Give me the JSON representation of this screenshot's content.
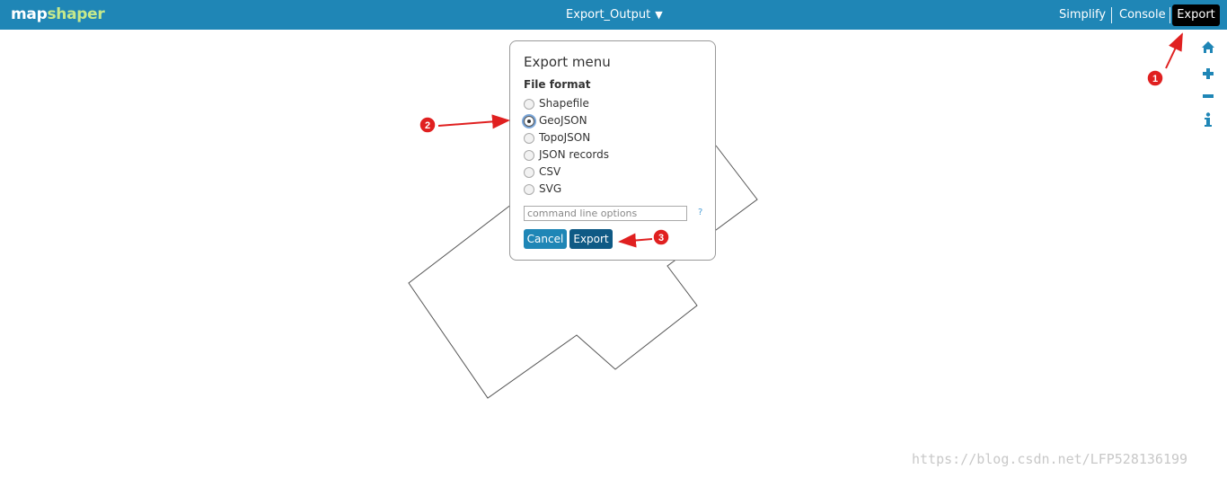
{
  "header": {
    "logo_part1": "map",
    "logo_part2": "shaper",
    "layer_name": "Export_Output",
    "layer_dropdown_icon": "triangle-down-icon",
    "nav": {
      "simplify": "Simplify",
      "console": "Console",
      "export": "Export"
    }
  },
  "tools": [
    "home-icon",
    "zoom-in-icon",
    "zoom-out-icon",
    "info-icon"
  ],
  "export_menu": {
    "title": "Export menu",
    "file_format_label": "File format",
    "formats": [
      "Shapefile",
      "GeoJSON",
      "TopoJSON",
      "JSON records",
      "CSV",
      "SVG"
    ],
    "selected_format": "GeoJSON",
    "options_placeholder": "command line options",
    "help": "?",
    "cancel_label": "Cancel",
    "export_label": "Export"
  },
  "annotations": [
    "1",
    "2",
    "3"
  ],
  "watermark": "https://blog.csdn.net/LFP528136199",
  "colors": {
    "topbar": "#1f86b6",
    "logo_accent": "#c6e98b",
    "active_nav": "#000000",
    "button_cancel": "#1f86b6",
    "button_export": "#0f5a85",
    "annotation": "#e02020"
  }
}
